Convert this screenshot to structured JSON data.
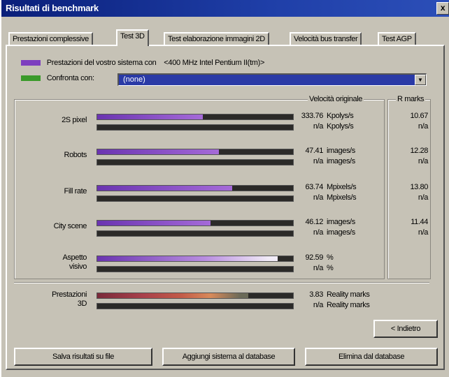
{
  "window": {
    "title": "Risultati di benchmark",
    "close_glyph": "x"
  },
  "tabs": [
    {
      "label": "Prestazioni complessive",
      "active": false
    },
    {
      "label": "Test 3D",
      "active": true
    },
    {
      "label": "Test elaborazione immagini 2D",
      "active": false
    },
    {
      "label": "Velocità bus transfer",
      "active": false
    },
    {
      "label": "Test AGP",
      "active": false
    }
  ],
  "legend": {
    "system_label": "Prestazioni del vostro sistema con",
    "system_value": "<400 MHz Intel Pentium II(tm)>",
    "system_color": "#7d3fbf",
    "compare_label": "Confronta con:",
    "compare_color": "#3a9a2a",
    "compare_value": "(none)",
    "compare_dropdown_icon": "triangle-down"
  },
  "columns": {
    "velocity": "Velocità originale",
    "rmarks": "R marks"
  },
  "rows": [
    {
      "label": "2S pixel",
      "fill": 0.54,
      "value": "333.76",
      "unit": "Kpolys/s",
      "compare_value": "n/a",
      "compare_unit": "Kpolys/s",
      "rmark": "10.67",
      "compare_rmark": "n/a"
    },
    {
      "label": "Robots",
      "fill": 0.62,
      "value": "47.41",
      "unit": "images/s",
      "compare_value": "n/a",
      "compare_unit": "images/s",
      "rmark": "12.28",
      "compare_rmark": "n/a"
    },
    {
      "label": "Fill rate",
      "fill": 0.69,
      "value": "63.74",
      "unit": "Mpixels/s",
      "compare_value": "n/a",
      "compare_unit": "Mpixels/s",
      "rmark": "13.80",
      "compare_rmark": "n/a"
    },
    {
      "label": "City scene",
      "fill": 0.58,
      "value": "46.12",
      "unit": "images/s",
      "compare_value": "n/a",
      "compare_unit": "images/s",
      "rmark": "11.44",
      "compare_rmark": "n/a"
    },
    {
      "label": "Aspetto\nvisivo",
      "fill": 0.92,
      "value": "92.59",
      "unit": "%",
      "compare_value": "n/a",
      "compare_unit": "%",
      "rmark": "",
      "compare_rmark": ""
    }
  ],
  "overall": {
    "label": "Prestazioni\n3D",
    "fill": 0.77,
    "value": "3.83",
    "unit": "Reality marks",
    "compare_value": "n/a",
    "compare_unit": "Reality marks"
  },
  "buttons": {
    "back": "< Indietro",
    "save": "Salva risultati su file",
    "add": "Aggiungi sistema al database",
    "delete": "Elimina dal database"
  }
}
